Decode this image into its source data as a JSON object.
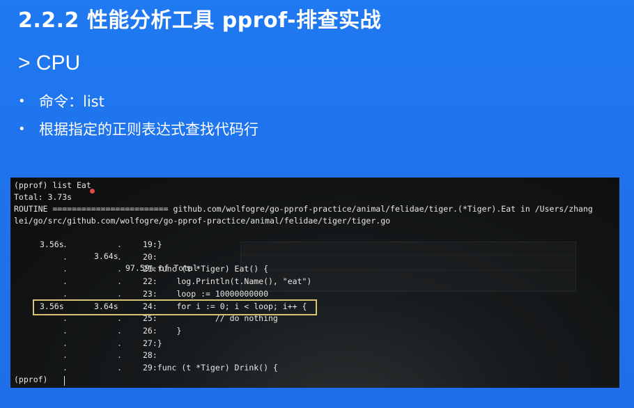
{
  "slide": {
    "title": "2.2.2 性能分析工具 pprof-排查实战",
    "subtitle": "> CPU",
    "bullets": [
      "命令：list",
      "根据指定的正则表达式查找代码行"
    ],
    "bullet_symbol": "•"
  },
  "terminal": {
    "header_lines": [
      "(pprof) list Eat",
      "Total: 3.73s",
      "ROUTINE ======================== github.com/wolfogre/go-pprof-practice/animal/felidae/tiger.(*Tiger).Eat in /Users/zhang",
      "lei/go/src/github.com/wolfogre/go-pprof-practice/animal/felidae/tiger/tiger.go"
    ],
    "summary": {
      "flat": "3.56s",
      "cum": "3.64s",
      "text": "97.59% of Total"
    },
    "code_rows": [
      {
        "flat": ".",
        "cum": ".",
        "code": "19:}"
      },
      {
        "flat": ".",
        "cum": ".",
        "code": "20:"
      },
      {
        "flat": ".",
        "cum": ".",
        "code": "21:func (t *Tiger) Eat() {"
      },
      {
        "flat": ".",
        "cum": ".",
        "code": "22:    log.Println(t.Name(), \"eat\")"
      },
      {
        "flat": ".",
        "cum": ".",
        "code": "23:    loop := 10000000000"
      },
      {
        "flat": "3.56s",
        "cum": "3.64s",
        "code": "24:    for i := 0; i < loop; i++ {"
      },
      {
        "flat": ".",
        "cum": ".",
        "code": "25:            // do nothing"
      },
      {
        "flat": ".",
        "cum": ".",
        "code": "26:    }"
      },
      {
        "flat": ".",
        "cum": ".",
        "code": "27:}"
      },
      {
        "flat": ".",
        "cum": ".",
        "code": "28:"
      },
      {
        "flat": ".",
        "cum": ".",
        "code": "29:func (t *Tiger) Drink() {"
      }
    ],
    "prompt": "(pprof)",
    "highlighted_row_index": 5
  },
  "colors": {
    "background": "#1f72ec",
    "highlight_border": "#d9c271",
    "terminal_bg": "#0c0d0e"
  }
}
